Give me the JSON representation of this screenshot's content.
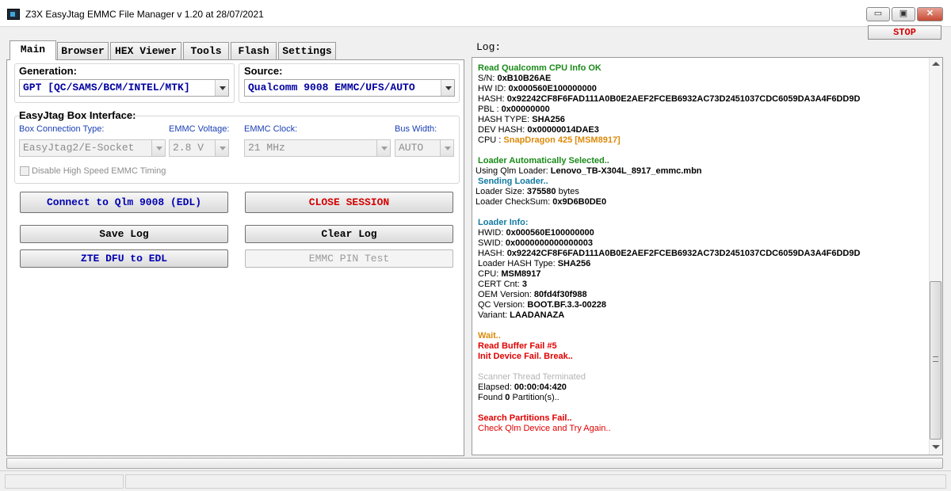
{
  "window": {
    "title": "Z3X EasyJtag EMMC File Manager v 1.20 at 28/07/2021",
    "minimize_glyph": "▭",
    "maximize_glyph": "▣",
    "close_glyph": "✕"
  },
  "stop_label": "STOP",
  "tabs": [
    "Main",
    "Browser",
    "HEX Viewer",
    "Tools",
    "Flash",
    "Settings"
  ],
  "main": {
    "generation_label": "Generation:",
    "generation_value": "GPT [QC/SAMS/BCM/INTEL/MTK]",
    "source_label": "Source:",
    "source_value": "Qualcomm 9008 EMMC/UFS/AUTO",
    "box_interface_label": "EasyJtag Box Interface:",
    "box_conn_label": "Box Connection Type:",
    "box_conn_value": "EasyJtag2/E-Socket",
    "emmc_voltage_label": "EMMC Voltage:",
    "emmc_voltage_value": "2.8 V",
    "emmc_clock_label": "EMMC Clock:",
    "emmc_clock_value": "21 MHz",
    "bus_width_label": "Bus Width:",
    "bus_width_value": "AUTO",
    "disable_hs_label": "Disable High Speed EMMC Timing",
    "connect_label": "Connect to Qlm 9008 (EDL)",
    "close_session_label": "CLOSE SESSION",
    "save_log_label": "Save Log",
    "clear_log_label": "Clear Log",
    "zte_label": "ZTE DFU to EDL",
    "emmc_pin_label": "EMMC PIN Test"
  },
  "log": {
    "title": "Log:",
    "lines": [
      {
        "k": "Read Qualcomm CPU Info OK",
        "v": "",
        "s": "green",
        "ind": 1
      },
      {
        "k": "S/N:",
        "v": "0xB10B26AE",
        "s": "",
        "ind": 1
      },
      {
        "k": "HW ID:",
        "v": "0x000560E100000000",
        "s": "",
        "ind": 1
      },
      {
        "k": "HASH:",
        "v": "0x92242CF8F6FAD111A0B0E2AEF2FCEB6932AC73D2451037CDC6059DA3A4F6DD9D",
        "s": "",
        "ind": 1
      },
      {
        "k": "PBL :",
        "v": "0x00000000",
        "s": "",
        "ind": 1
      },
      {
        "k": "HASH TYPE:",
        "v": "SHA256",
        "s": "",
        "ind": 1
      },
      {
        "k": "DEV HASH:",
        "v": "0x00000014DAE3",
        "s": "",
        "ind": 1
      },
      {
        "k": "CPU :",
        "v": "SnapDragon 425 [MSM8917]",
        "s": "orange-v",
        "ind": 1
      },
      {
        "k": "",
        "v": "",
        "s": "",
        "ind": 0
      },
      {
        "k": "Loader Automatically Selected..",
        "v": "",
        "s": "green",
        "ind": 1
      },
      {
        "k": "Using Qlm Loader:",
        "v": "Lenovo_TB-X304L_8917_emmc.mbn",
        "s": "",
        "ind": 0
      },
      {
        "k": "Sending Loader..",
        "v": "",
        "s": "teal",
        "ind": 1
      },
      {
        "k": "Loader Size:",
        "v": "375580",
        "suffix": " bytes",
        "s": "",
        "ind": 0
      },
      {
        "k": "Loader CheckSum:",
        "v": "0x9D6B0DE0",
        "s": "",
        "ind": 0
      },
      {
        "k": "",
        "v": "",
        "s": "",
        "ind": 0
      },
      {
        "k": "Loader Info:",
        "v": "",
        "s": "teal",
        "ind": 1
      },
      {
        "k": "HWID:",
        "v": "0x000560E100000000",
        "s": "",
        "ind": 1
      },
      {
        "k": "SWID:",
        "v": "0x0000000000000003",
        "s": "",
        "ind": 1
      },
      {
        "k": "HASH:",
        "v": "0x92242CF8F6FAD111A0B0E2AEF2FCEB6932AC73D2451037CDC6059DA3A4F6DD9D",
        "s": "",
        "ind": 1
      },
      {
        "k": "Loader HASH Type:",
        "v": "SHA256",
        "s": "",
        "ind": 1
      },
      {
        "k": "CPU:",
        "v": " MSM8917",
        "s": "",
        "ind": 1
      },
      {
        "k": "CERT Cnt:",
        "v": "3",
        "s": "",
        "ind": 1
      },
      {
        "k": "OEM Version:",
        "v": "80fd4f30f988",
        "s": "",
        "ind": 1
      },
      {
        "k": "QC Version:",
        "v": "BOOT.BF.3.3-00228",
        "s": "",
        "ind": 1
      },
      {
        "k": "Variant:",
        "v": "LAADANAZA",
        "s": "",
        "ind": 1
      },
      {
        "k": "",
        "v": "",
        "s": "",
        "ind": 0
      },
      {
        "k": "Wait..",
        "v": "",
        "s": "orange",
        "ind": 1
      },
      {
        "k": "Read Buffer Fail #5",
        "v": "",
        "s": "red",
        "ind": 1
      },
      {
        "k": "Init Device Fail. Break..",
        "v": "",
        "s": "red",
        "ind": 1
      },
      {
        "k": "",
        "v": "",
        "s": "",
        "ind": 0
      },
      {
        "k": "Scanner Thread Terminated",
        "v": "",
        "s": "gray",
        "ind": 1
      },
      {
        "k": "Elapsed:",
        "v": "00:00:04:420",
        "s": "",
        "ind": 1
      },
      {
        "k": "Found",
        "v": "0",
        "suffix": " Partition(s)..",
        "s": "",
        "ind": 1
      },
      {
        "k": "",
        "v": "",
        "s": "",
        "ind": 0
      },
      {
        "k": "Search Partitions Fail..",
        "v": "",
        "s": "red",
        "ind": 1
      },
      {
        "k": "Check Qlm Device and Try Again..",
        "v": "",
        "s": "redn",
        "ind": 1
      }
    ]
  }
}
